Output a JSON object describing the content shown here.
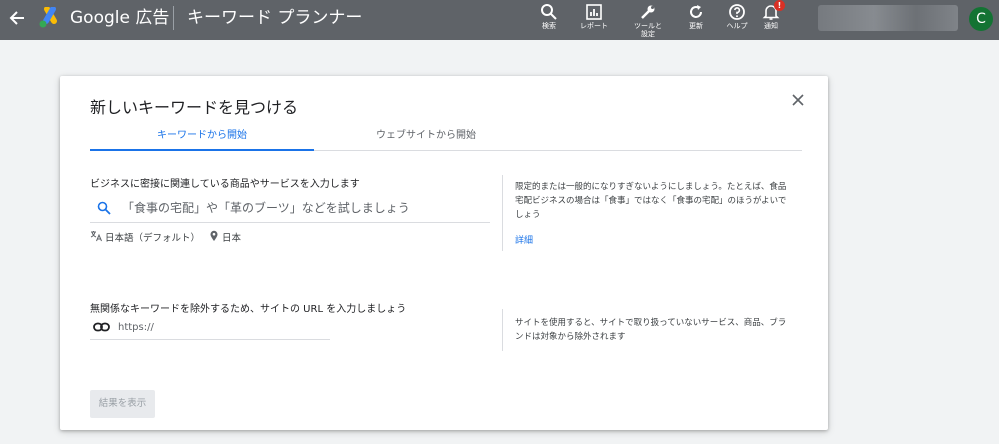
{
  "header": {
    "back_icon": "arrow-left-icon",
    "logo_icon": "google-ads-logo",
    "brand": "Google 広告",
    "tool_title": "キーワード プランナー",
    "nav": [
      {
        "name": "search",
        "icon": "search-icon",
        "label": "検索"
      },
      {
        "name": "reports",
        "icon": "bar-chart-icon",
        "label": "レポート"
      },
      {
        "name": "tools",
        "icon": "wrench-icon",
        "label": "ツールと設定"
      },
      {
        "name": "refresh",
        "icon": "refresh-icon",
        "label": "更新"
      },
      {
        "name": "help",
        "icon": "help-icon",
        "label": "ヘルプ"
      },
      {
        "name": "notifications",
        "icon": "bell-icon",
        "label": "通知",
        "badge": "!"
      }
    ],
    "avatar_letter": "C"
  },
  "dialog": {
    "title": "新しいキーワードを見つける",
    "tabs": [
      {
        "label": "キーワードから開始",
        "active": true
      },
      {
        "label": "ウェブサイトから開始",
        "active": false
      }
    ],
    "keyword_section": {
      "label": "ビジネスに密接に関連している商品やサービスを入力します",
      "placeholder": "「食事の宅配」や「革のブーツ」などを試しましょう",
      "value": "",
      "language": "日本語（デフォルト）",
      "location": "日本",
      "hint": "限定的または一般的になりすぎないようにしましょう。たとえば、食品宅配ビジネスの場合は「食事」ではなく「食事の宅配」のほうがよいでしょう",
      "details_link": "詳細"
    },
    "site_section": {
      "label": "無関係なキーワードを除外するため、サイトの URL を入力しましょう",
      "placeholder": "https://",
      "value": "",
      "hint": "サイトを使用すると、サイトで取り扱っていないサービス、商品、ブランドは対象から除外されます"
    },
    "submit_label": "結果を表示"
  },
  "colors": {
    "topbar": "#5f6368",
    "accent": "#1a73e8",
    "avatar": "#137333",
    "badge": "#d93025"
  }
}
